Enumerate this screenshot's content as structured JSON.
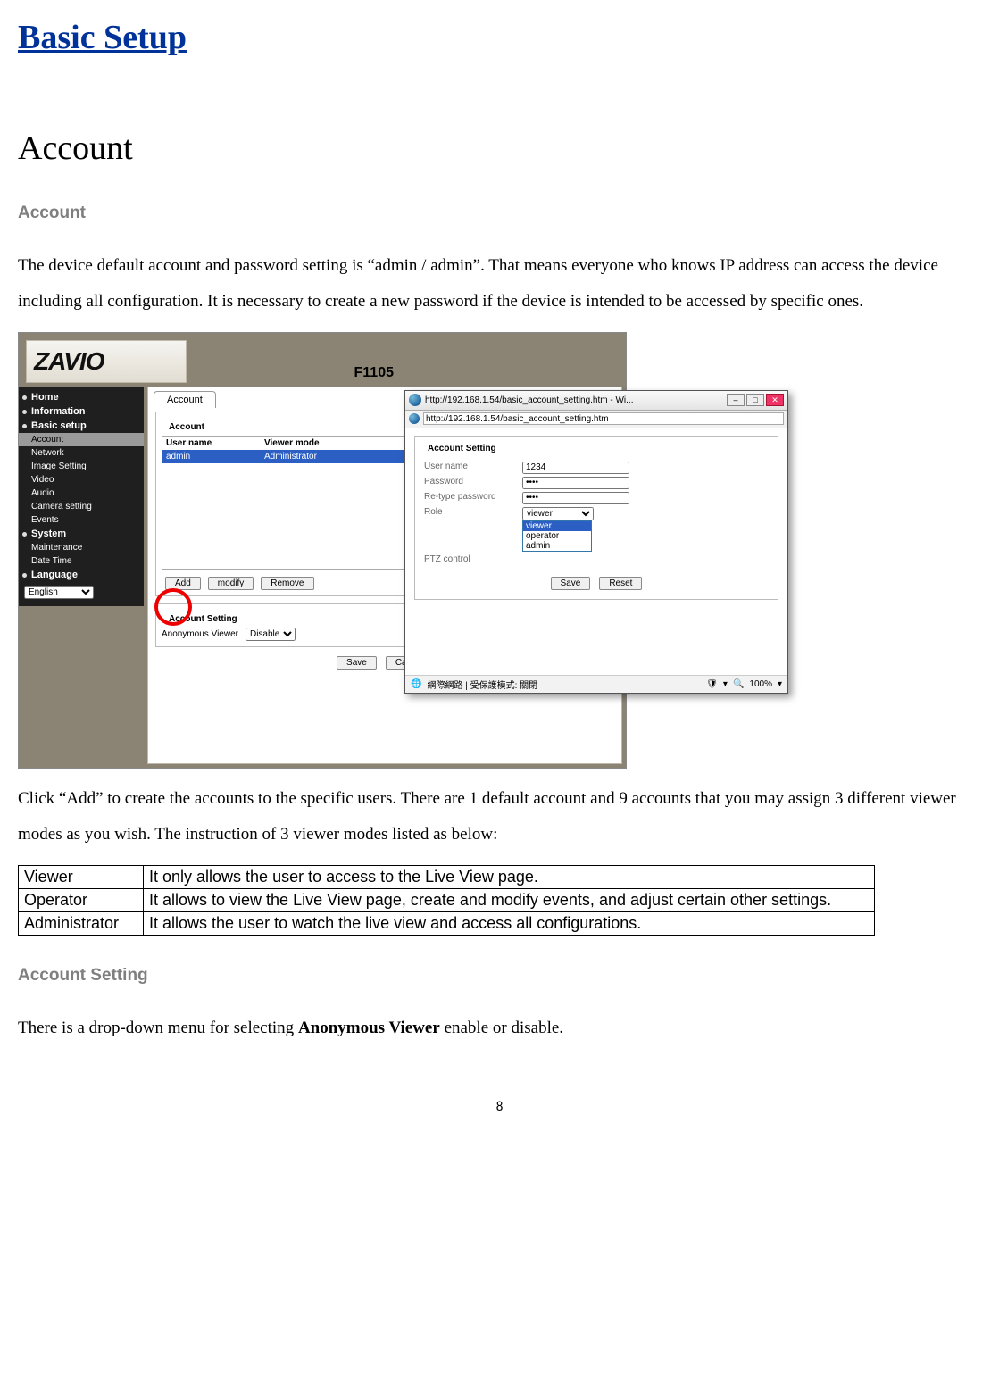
{
  "page_title": "Basic Setup",
  "section_title": "Account",
  "subheading_account": "Account",
  "para1": "The device default account and password setting is “admin / admin”. That means everyone who knows IP address can access the device including all configuration. It is necessary to create a new password if the device is intended to be accessed by specific ones.",
  "para2": "Click “Add” to create the accounts to the specific users. There are 1 default account and 9 accounts that you may assign 3 different viewer modes as you wish. The instruction of 3 viewer modes listed as below:",
  "subheading_setting": "Account Setting",
  "para3_pre": "There is a drop-down menu for selecting ",
  "para3_bold": "Anonymous Viewer",
  "para3_post": " enable or disable.",
  "page_number": "8",
  "shot": {
    "logo_text": "ZAVIO",
    "model": "F1105",
    "sidebar": {
      "home": "Home",
      "information": "Information",
      "basic_setup": "Basic setup",
      "account": "Account",
      "network": "Network",
      "image_setting": "Image Setting",
      "video": "Video",
      "audio": "Audio",
      "camera_setting": "Camera setting",
      "events": "Events",
      "system": "System",
      "maintenance": "Maintenance",
      "date_time": "Date Time",
      "language": "Language",
      "lang_value": "English"
    },
    "tab_label": "Account",
    "account_group_label": "Account",
    "col_user": "User name",
    "col_mode": "Viewer mode",
    "row_user": "admin",
    "row_mode": "Administrator",
    "btn_add": "Add",
    "btn_modify": "modify",
    "btn_remove": "Remove",
    "setting_group_label": "Account Setting",
    "anon_label": "Anonymous Viewer",
    "anon_value": "Disable",
    "btn_save": "Save",
    "btn_cancel": "Cancel"
  },
  "popup": {
    "title": "http://192.168.1.54/basic_account_setting.htm - Wi...",
    "url": "http://192.168.1.54/basic_account_setting.htm",
    "fs_label": "Account Setting",
    "lab_user": "User name",
    "lab_pass": "Password",
    "lab_repass": "Re-type password",
    "lab_role": "Role",
    "lab_ptz": "PTZ control",
    "val_user": "1234",
    "val_pass": "••••",
    "val_repass": "••••",
    "role_selected": "viewer",
    "role_opts": {
      "0": "viewer",
      "1": "operator",
      "2": "admin"
    },
    "btn_save": "Save",
    "btn_reset": "Reset",
    "status_text": "網際網路 | 受保護模式: 關閉",
    "zoom": "100%"
  },
  "modes": {
    "viewer_name": "Viewer",
    "viewer_desc": "It only allows the user to access to the Live View page.",
    "operator_name": "Operator",
    "operator_desc": "It allows to view the Live View page, create and modify events, and adjust certain other settings.",
    "admin_name": "Administrator",
    "admin_desc": "It allows the user to watch the live view and access all configurations."
  }
}
